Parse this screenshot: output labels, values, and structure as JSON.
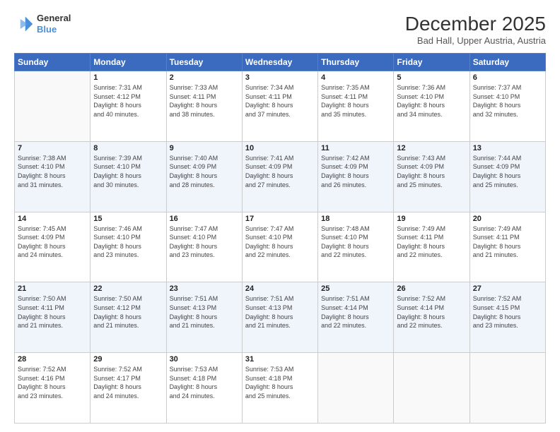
{
  "header": {
    "logo_line1": "General",
    "logo_line2": "Blue",
    "month": "December 2025",
    "location": "Bad Hall, Upper Austria, Austria"
  },
  "weekdays": [
    "Sunday",
    "Monday",
    "Tuesday",
    "Wednesday",
    "Thursday",
    "Friday",
    "Saturday"
  ],
  "weeks": [
    [
      {
        "day": "",
        "lines": []
      },
      {
        "day": "1",
        "lines": [
          "Sunrise: 7:31 AM",
          "Sunset: 4:12 PM",
          "Daylight: 8 hours",
          "and 40 minutes."
        ]
      },
      {
        "day": "2",
        "lines": [
          "Sunrise: 7:33 AM",
          "Sunset: 4:11 PM",
          "Daylight: 8 hours",
          "and 38 minutes."
        ]
      },
      {
        "day": "3",
        "lines": [
          "Sunrise: 7:34 AM",
          "Sunset: 4:11 PM",
          "Daylight: 8 hours",
          "and 37 minutes."
        ]
      },
      {
        "day": "4",
        "lines": [
          "Sunrise: 7:35 AM",
          "Sunset: 4:11 PM",
          "Daylight: 8 hours",
          "and 35 minutes."
        ]
      },
      {
        "day": "5",
        "lines": [
          "Sunrise: 7:36 AM",
          "Sunset: 4:10 PM",
          "Daylight: 8 hours",
          "and 34 minutes."
        ]
      },
      {
        "day": "6",
        "lines": [
          "Sunrise: 7:37 AM",
          "Sunset: 4:10 PM",
          "Daylight: 8 hours",
          "and 32 minutes."
        ]
      }
    ],
    [
      {
        "day": "7",
        "lines": [
          "Sunrise: 7:38 AM",
          "Sunset: 4:10 PM",
          "Daylight: 8 hours",
          "and 31 minutes."
        ]
      },
      {
        "day": "8",
        "lines": [
          "Sunrise: 7:39 AM",
          "Sunset: 4:10 PM",
          "Daylight: 8 hours",
          "and 30 minutes."
        ]
      },
      {
        "day": "9",
        "lines": [
          "Sunrise: 7:40 AM",
          "Sunset: 4:09 PM",
          "Daylight: 8 hours",
          "and 28 minutes."
        ]
      },
      {
        "day": "10",
        "lines": [
          "Sunrise: 7:41 AM",
          "Sunset: 4:09 PM",
          "Daylight: 8 hours",
          "and 27 minutes."
        ]
      },
      {
        "day": "11",
        "lines": [
          "Sunrise: 7:42 AM",
          "Sunset: 4:09 PM",
          "Daylight: 8 hours",
          "and 26 minutes."
        ]
      },
      {
        "day": "12",
        "lines": [
          "Sunrise: 7:43 AM",
          "Sunset: 4:09 PM",
          "Daylight: 8 hours",
          "and 25 minutes."
        ]
      },
      {
        "day": "13",
        "lines": [
          "Sunrise: 7:44 AM",
          "Sunset: 4:09 PM",
          "Daylight: 8 hours",
          "and 25 minutes."
        ]
      }
    ],
    [
      {
        "day": "14",
        "lines": [
          "Sunrise: 7:45 AM",
          "Sunset: 4:09 PM",
          "Daylight: 8 hours",
          "and 24 minutes."
        ]
      },
      {
        "day": "15",
        "lines": [
          "Sunrise: 7:46 AM",
          "Sunset: 4:10 PM",
          "Daylight: 8 hours",
          "and 23 minutes."
        ]
      },
      {
        "day": "16",
        "lines": [
          "Sunrise: 7:47 AM",
          "Sunset: 4:10 PM",
          "Daylight: 8 hours",
          "and 23 minutes."
        ]
      },
      {
        "day": "17",
        "lines": [
          "Sunrise: 7:47 AM",
          "Sunset: 4:10 PM",
          "Daylight: 8 hours",
          "and 22 minutes."
        ]
      },
      {
        "day": "18",
        "lines": [
          "Sunrise: 7:48 AM",
          "Sunset: 4:10 PM",
          "Daylight: 8 hours",
          "and 22 minutes."
        ]
      },
      {
        "day": "19",
        "lines": [
          "Sunrise: 7:49 AM",
          "Sunset: 4:11 PM",
          "Daylight: 8 hours",
          "and 22 minutes."
        ]
      },
      {
        "day": "20",
        "lines": [
          "Sunrise: 7:49 AM",
          "Sunset: 4:11 PM",
          "Daylight: 8 hours",
          "and 21 minutes."
        ]
      }
    ],
    [
      {
        "day": "21",
        "lines": [
          "Sunrise: 7:50 AM",
          "Sunset: 4:11 PM",
          "Daylight: 8 hours",
          "and 21 minutes."
        ]
      },
      {
        "day": "22",
        "lines": [
          "Sunrise: 7:50 AM",
          "Sunset: 4:12 PM",
          "Daylight: 8 hours",
          "and 21 minutes."
        ]
      },
      {
        "day": "23",
        "lines": [
          "Sunrise: 7:51 AM",
          "Sunset: 4:13 PM",
          "Daylight: 8 hours",
          "and 21 minutes."
        ]
      },
      {
        "day": "24",
        "lines": [
          "Sunrise: 7:51 AM",
          "Sunset: 4:13 PM",
          "Daylight: 8 hours",
          "and 21 minutes."
        ]
      },
      {
        "day": "25",
        "lines": [
          "Sunrise: 7:51 AM",
          "Sunset: 4:14 PM",
          "Daylight: 8 hours",
          "and 22 minutes."
        ]
      },
      {
        "day": "26",
        "lines": [
          "Sunrise: 7:52 AM",
          "Sunset: 4:14 PM",
          "Daylight: 8 hours",
          "and 22 minutes."
        ]
      },
      {
        "day": "27",
        "lines": [
          "Sunrise: 7:52 AM",
          "Sunset: 4:15 PM",
          "Daylight: 8 hours",
          "and 23 minutes."
        ]
      }
    ],
    [
      {
        "day": "28",
        "lines": [
          "Sunrise: 7:52 AM",
          "Sunset: 4:16 PM",
          "Daylight: 8 hours",
          "and 23 minutes."
        ]
      },
      {
        "day": "29",
        "lines": [
          "Sunrise: 7:52 AM",
          "Sunset: 4:17 PM",
          "Daylight: 8 hours",
          "and 24 minutes."
        ]
      },
      {
        "day": "30",
        "lines": [
          "Sunrise: 7:53 AM",
          "Sunset: 4:18 PM",
          "Daylight: 8 hours",
          "and 24 minutes."
        ]
      },
      {
        "day": "31",
        "lines": [
          "Sunrise: 7:53 AM",
          "Sunset: 4:18 PM",
          "Daylight: 8 hours",
          "and 25 minutes."
        ]
      },
      {
        "day": "",
        "lines": []
      },
      {
        "day": "",
        "lines": []
      },
      {
        "day": "",
        "lines": []
      }
    ]
  ]
}
